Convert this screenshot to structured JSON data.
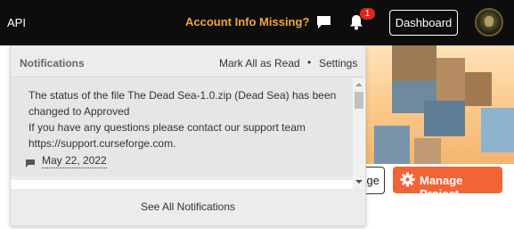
{
  "topbar": {
    "api_label": "API",
    "account_missing_label": "Account Info Missing?",
    "chat_icon": "chat-bubble-icon",
    "bell_icon": "bell-icon",
    "notification_count": "1",
    "dashboard_label": "Dashboard",
    "avatar_icon": "user-avatar"
  },
  "notifications": {
    "title": "Notifications",
    "mark_all_label": "Mark All as Read",
    "separator": "•",
    "settings_label": "Settings",
    "items": [
      {
        "line1": "The status of the file The Dead Sea-1.0.zip (Dead Sea) has been",
        "line2": "changed to Approved",
        "line3": "If you have any questions please contact our support team",
        "line4": "https://support.curseforge.com.",
        "date": "May 22, 2022",
        "icon": "flag-icon"
      }
    ],
    "see_all_label": "See All Notifications"
  },
  "project": {
    "partial_button_label": "ge",
    "manage_label": "Manage Project",
    "manage_icon": "gear-icon"
  },
  "colors": {
    "topbar_bg": "#0d0d0d",
    "account_missing": "#f0a53c",
    "badge": "#e0251b",
    "manage_button": "#f16436",
    "panel_bg": "#ececec"
  }
}
